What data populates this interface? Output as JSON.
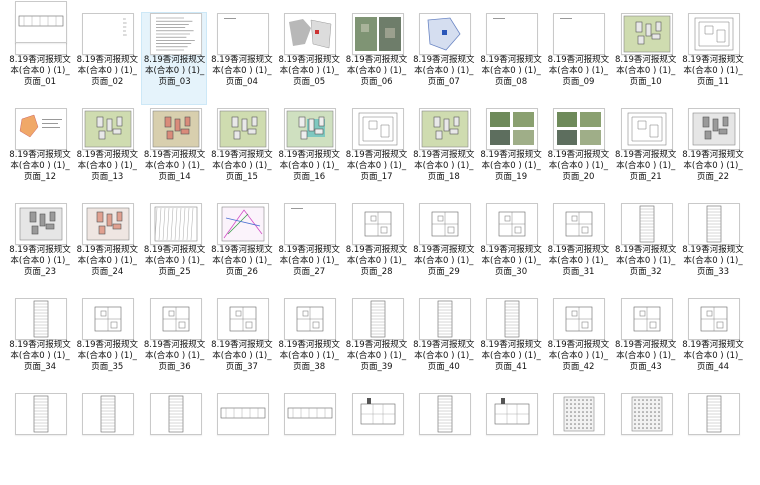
{
  "files": [
    {
      "label": "8.19香河报规文本(合本0 ) (1)_页面_01",
      "thumb": "cover"
    },
    {
      "label": "8.19香河报规文本(合本0 ) (1)_页面_02",
      "thumb": "blank-text"
    },
    {
      "label": "8.19香河报规文本(合本0 ) (1)_页面_03",
      "thumb": "text"
    },
    {
      "label": "8.19香河报规文本(合本0 ) (1)_页面_04",
      "thumb": "blank"
    },
    {
      "label": "8.19香河报规文本(合本0 ) (1)_页面_05",
      "thumb": "map-gray"
    },
    {
      "label": "8.19香河报规文本(合本0 ) (1)_页面_06",
      "thumb": "aerial"
    },
    {
      "label": "8.19香河报规文本(合本0 ) (1)_页面_07",
      "thumb": "map-blue"
    },
    {
      "label": "8.19香河报规文本(合本0 ) (1)_页面_08",
      "thumb": "blank"
    },
    {
      "label": "8.19香河报规文本(合本0 ) (1)_页面_09",
      "thumb": "blank"
    },
    {
      "label": "8.19香河报规文本(合本0 ) (1)_页面_10",
      "thumb": "site-green"
    },
    {
      "label": "8.19香河报规文本(合本0 ) (1)_页面_11",
      "thumb": "line-plan"
    },
    {
      "label": "8.19香河报规文本(合本0 ) (1)_页面_12",
      "thumb": "orange-plan"
    },
    {
      "label": "8.19香河报规文本(合本0 ) (1)_页面_13",
      "thumb": "site-green"
    },
    {
      "label": "8.19香河报规文本(合本0 ) (1)_页面_14",
      "thumb": "site-red"
    },
    {
      "label": "8.19香河报规文本(合本0 ) (1)_页面_15",
      "thumb": "site-green"
    },
    {
      "label": "8.19香河报规文本(合本0 ) (1)_页面_16",
      "thumb": "site-teal"
    },
    {
      "label": "8.19香河报规文本(合本0 ) (1)_页面_17",
      "thumb": "line-plan"
    },
    {
      "label": "8.19香河报规文本(合本0 ) (1)_页面_18",
      "thumb": "site-green"
    },
    {
      "label": "8.19香河报规文本(合本0 ) (1)_页面_19",
      "thumb": "photos"
    },
    {
      "label": "8.19香河报规文本(合本0 ) (1)_页面_20",
      "thumb": "photos"
    },
    {
      "label": "8.19香河报规文本(合本0 ) (1)_页面_21",
      "thumb": "line-plan"
    },
    {
      "label": "8.19香河报规文本(合本0 ) (1)_页面_22",
      "thumb": "gray-plan"
    },
    {
      "label": "8.19香河报规文本(合本0 ) (1)_页面_23",
      "thumb": "gray-plan"
    },
    {
      "label": "8.19香河报规文本(合本0 ) (1)_页面_24",
      "thumb": "red-plan"
    },
    {
      "label": "8.19香河报规文本(合本0 ) (1)_页面_25",
      "thumb": "hatch"
    },
    {
      "label": "8.19香河报规文本(合本0 ) (1)_页面_26",
      "thumb": "color-lines"
    },
    {
      "label": "8.19香河报规文本(合本0 ) (1)_页面_27",
      "thumb": "blank"
    },
    {
      "label": "8.19香河报规文本(合本0 ) (1)_页面_28",
      "thumb": "floor"
    },
    {
      "label": "8.19香河报规文本(合本0 ) (1)_页面_29",
      "thumb": "floor"
    },
    {
      "label": "8.19香河报规文本(合本0 ) (1)_页面_30",
      "thumb": "floor"
    },
    {
      "label": "8.19香河报规文本(合本0 ) (1)_页面_31",
      "thumb": "floor"
    },
    {
      "label": "8.19香河报规文本(合本0 ) (1)_页面_32",
      "thumb": "elevation"
    },
    {
      "label": "8.19香河报规文本(合本0 ) (1)_页面_33",
      "thumb": "elevation"
    },
    {
      "label": "8.19香河报规文本(合本0 ) (1)_页面_34",
      "thumb": "elevation"
    },
    {
      "label": "8.19香河报规文本(合本0 ) (1)_页面_35",
      "thumb": "floor"
    },
    {
      "label": "8.19香河报规文本(合本0 ) (1)_页面_36",
      "thumb": "floor"
    },
    {
      "label": "8.19香河报规文本(合本0 ) (1)_页面_37",
      "thumb": "floor"
    },
    {
      "label": "8.19香河报规文本(合本0 ) (1)_页面_38",
      "thumb": "floor"
    },
    {
      "label": "8.19香河报规文本(合本0 ) (1)_页面_39",
      "thumb": "elevation"
    },
    {
      "label": "8.19香河报规文本(合本0 ) (1)_页面_40",
      "thumb": "elevation"
    },
    {
      "label": "8.19香河报规文本(合本0 ) (1)_页面_41",
      "thumb": "elevation"
    },
    {
      "label": "8.19香河报规文本(合本0 ) (1)_页面_42",
      "thumb": "floor"
    },
    {
      "label": "8.19香河报规文本(合本0 ) (1)_页面_43",
      "thumb": "floor"
    },
    {
      "label": "8.19香河报规文本(合本0 ) (1)_页面_44",
      "thumb": "floor"
    },
    {
      "label": "",
      "thumb": "elevation"
    },
    {
      "label": "",
      "thumb": "elevation"
    },
    {
      "label": "",
      "thumb": "elevation"
    },
    {
      "label": "",
      "thumb": "wide-plan"
    },
    {
      "label": "",
      "thumb": "wide-plan"
    },
    {
      "label": "",
      "thumb": "section"
    },
    {
      "label": "",
      "thumb": "elevation"
    },
    {
      "label": "",
      "thumb": "section"
    },
    {
      "label": "",
      "thumb": "dotted"
    },
    {
      "label": "",
      "thumb": "dotted"
    },
    {
      "label": "",
      "thumb": "elevation"
    },
    {
      "label": "",
      "thumb": "wide-plan"
    }
  ],
  "selected_index": 2
}
